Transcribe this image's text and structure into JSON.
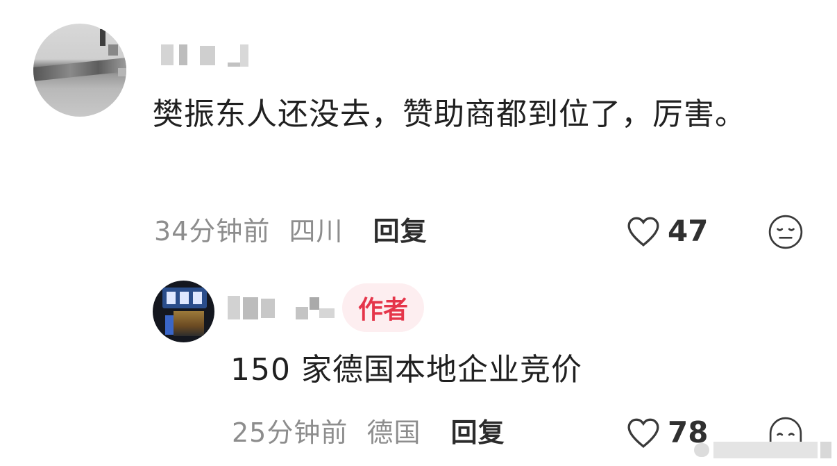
{
  "comment": {
    "text": "樊振东人还没去，赞助商都到位了，厉害。",
    "time": "34分钟前",
    "location": "四川",
    "reply_label": "回复",
    "likes": "47",
    "like_icon": "heart-outline-icon",
    "reaction_icon": "expressionless-face-icon"
  },
  "reply": {
    "badge": "作者",
    "text": "150 家德国本地企业竞价",
    "time": "25分钟前",
    "location": "德国",
    "reply_label": "回复",
    "likes": "78",
    "like_icon": "heart-outline-icon",
    "reaction_icon": "ghost-face-icon"
  },
  "colors": {
    "author_badge_text": "#e5354a",
    "author_badge_bg": "#fdeef0",
    "meta_text": "#8d8d8d"
  }
}
